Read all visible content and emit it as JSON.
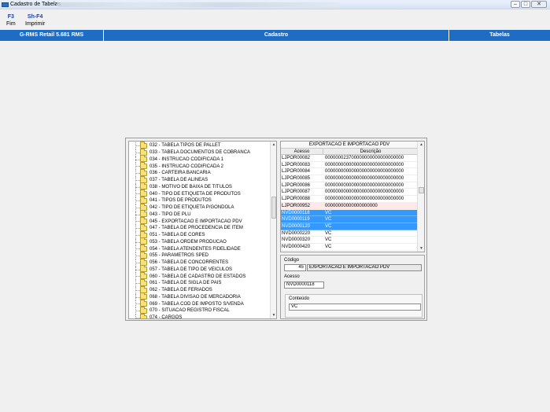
{
  "window": {
    "title": "Cadastro de Tabelas",
    "controls": [
      "–",
      "□",
      "✕"
    ]
  },
  "toolbar": {
    "items": [
      {
        "key": "F3",
        "label": "Fim"
      },
      {
        "key": "Sh-F4",
        "label": "Imprimir"
      }
    ]
  },
  "header": {
    "app_name": "G-RMS Retail 5.681 RMS",
    "section": "Cadastro",
    "module": "Tabelas"
  },
  "tree": {
    "items": [
      "032 - TABELA TIPOS DE PALLET",
      "033 - TABELA DOCUMENTOS DE COBRANCA",
      "034 - INSTRUCAO CODIFICADA 1",
      "035 - INSTRUCAO CODIFICADA 2",
      "036 - CARTEIRA BANCARIA",
      "037 - TABELA DE ALINEAS",
      "038 - MOTIVO DE BAIXA DE TITULOS",
      "040 - TIPO DE ETIQUETA DE PRODUTOS",
      "041 - TIPOS DE PRODUTOS",
      "042 - TIPO DE ETIQUETA P/GONDOLA",
      "043 - TIPO DE PLU",
      "045 - EXPORTACAO E IMPORTACAO PDV",
      "047 - TABELA DE PROCEDENCIA DE ITEM",
      "051 - TABELA DE CORES",
      "053 - TABELA ORDEM PRODUCAO",
      "054 - TABELA ATENDENTES FIDELIDADE",
      "055 - PARAMETROS SPED",
      "056 - TABELA DE CONCORRENTES",
      "057 - TABELA DE TIPO DE VEICULOS",
      "060 - TABELA DE CADASTRO DE ESTADOS",
      "061 - TABELA DE SIGLA DE PAIS",
      "062 - TABELA DE FERIADOS",
      "068 - TABELA  DIVISAO DE MERCADORIA",
      "069 - TABELA COD DE IMPOSTO S/VENDA",
      "070 - SITUACAO REGISTRO FISCAL",
      "074 - CARGOS"
    ]
  },
  "grid": {
    "title": "EXPORTACAO E IMPORTACAO PDV",
    "columns": [
      "Acesso",
      "Descrição"
    ],
    "rows": [
      {
        "acesso": "LJPOR00082",
        "descricao": "000000023700000000000000000000",
        "state": ""
      },
      {
        "acesso": "LJPOR00083",
        "descricao": "000000000000000000000000000000",
        "state": ""
      },
      {
        "acesso": "LJPOR00084",
        "descricao": "000000000000000000000000000000",
        "state": ""
      },
      {
        "acesso": "LJPOR00085",
        "descricao": "000000000000000000000000000000",
        "state": ""
      },
      {
        "acesso": "LJPOR00086",
        "descricao": "000000000000000000000000000000",
        "state": ""
      },
      {
        "acesso": "LJPOR00087",
        "descricao": "000000000000000000000000000000",
        "state": ""
      },
      {
        "acesso": "LJPOR00088",
        "descricao": "000000000000000000000000000000",
        "state": ""
      },
      {
        "acesso": "LJPOR00952",
        "descricao": "00000000000000000000",
        "state": "cur"
      },
      {
        "acesso": "NVD0000118",
        "descricao": "VC",
        "state": "sel"
      },
      {
        "acesso": "NVD0000119",
        "descricao": "VC",
        "state": "sel"
      },
      {
        "acesso": "NVD0000120",
        "descricao": "VC",
        "state": "sel"
      },
      {
        "acesso": "NVD0000220",
        "descricao": "VC",
        "state": ""
      },
      {
        "acesso": "NVD0000320",
        "descricao": "VC",
        "state": ""
      },
      {
        "acesso": "NVD0000420",
        "descricao": "VC",
        "state": ""
      }
    ]
  },
  "detail": {
    "codigo_label": "Código",
    "codigo_value": "45",
    "codigo_desc": "EXPORTACAO E IMPORTACAO PDV",
    "acesso_label": "Acesso",
    "acesso_value": "NVD0000118",
    "conteudo_label": "Conteúdo",
    "conteudo_value": "VC"
  },
  "colors": {
    "header_band": "#1f6cc4",
    "selection": "#3399ff",
    "current_row": "#fde9e7",
    "toolbar_key": "#1f3f9f"
  }
}
